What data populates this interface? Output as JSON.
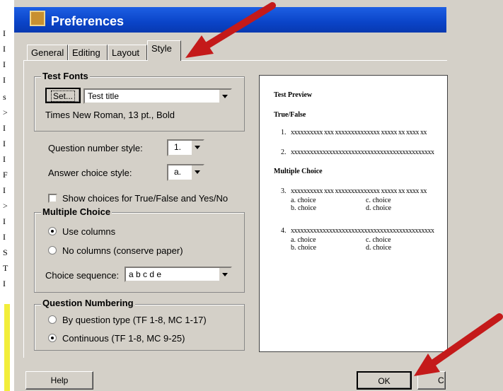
{
  "window": {
    "title": "Preferences"
  },
  "tabs": [
    {
      "label": "General",
      "u": "G"
    },
    {
      "label": "Editing",
      "u": "E"
    },
    {
      "label": "Layout",
      "u": "L"
    },
    {
      "label": "Style",
      "u": "S"
    }
  ],
  "fonts": {
    "group_title": "Test Fonts",
    "set_label": "Set...",
    "font_select": "Test title",
    "font_desc": "Times New Roman, 13 pt., Bold"
  },
  "question_number": {
    "label": "Question number style:",
    "value": "1."
  },
  "answer_choice": {
    "label": "Answer choice style:",
    "value": "a."
  },
  "show_choices": {
    "label": "Show choices for True/False and Yes/No",
    "checked": false
  },
  "multiple_choice": {
    "group_title": "Multiple Choice",
    "use_columns": "Use columns",
    "no_columns": "No columns (conserve paper)",
    "selected": "use_columns",
    "sequence_label": "Choice sequence:",
    "sequence_value": "a b c d e"
  },
  "numbering": {
    "group_title": "Question Numbering",
    "by_type": "By question type (TF 1-8, MC 1-17)",
    "continuous": "Continuous (TF 1-8, MC 9-25)",
    "selected": "continuous"
  },
  "preview": {
    "title": "Test Preview",
    "tf_heading": "True/False",
    "tf_items": [
      {
        "num": "1.",
        "text": "xxxxxxxxxx xxx xxxxxxxxxxxxxx xxxxx xx xxxx xx"
      },
      {
        "num": "2.",
        "text": "xxxxxxxxxxxxxxxxxxxxxxxxxxxxxxxxxxxxxxxxxxxxx"
      }
    ],
    "mc_heading": "Multiple Choice",
    "mc_items": [
      {
        "num": "3.",
        "text": "xxxxxxxxxx xxx xxxxxxxxxxxxxx xxxxx xx xxxx xx",
        "a": "a. choice",
        "b": "b. choice",
        "c": "c. choice",
        "d": "d. choice"
      },
      {
        "num": "4.",
        "text": "xxxxxxxxxxxxxxxxxxxxxxxxxxxxxxxxxxxxxxxxxxxxx",
        "a": "a. choice",
        "b": "b. choice",
        "c": "c. choice",
        "d": "d. choice"
      }
    ]
  },
  "buttons": {
    "help": "Help",
    "ok": "OK",
    "cancel": "C"
  },
  "colors": {
    "titlebar": "#0a44c8",
    "arrow": "#c41a1a",
    "dialog": "#d4d0c8"
  }
}
